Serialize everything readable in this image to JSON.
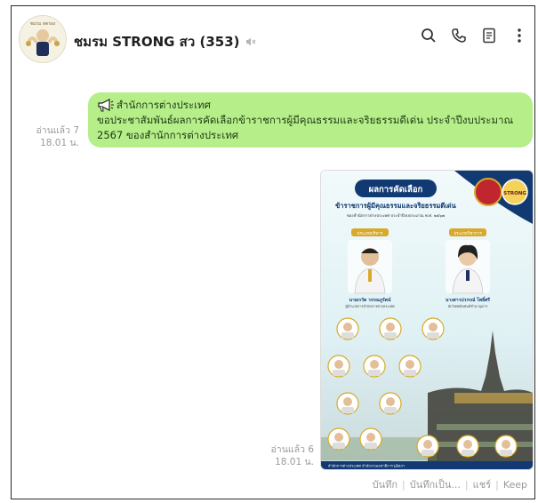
{
  "header": {
    "title": "ชมรม STRONG สว (353)",
    "avatar_caption": "ชมรม สตรอง"
  },
  "icons": {
    "mute": "speaker-muted-icon",
    "search": "search-icon",
    "call": "phone-icon",
    "notes": "notes-icon",
    "menu": "kebab-menu-icon"
  },
  "messages": [
    {
      "read": "อ่านแล้ว 7",
      "time": "18.01 น.",
      "line1": "สำนักการต่างประเทศ",
      "line2": "ขอประชาสัมพันธ์ผลการคัดเลือกข้าราชการผู้มีคุณธรรมและจริยธรรมดีเด่น ประจำปีงบประมาณ",
      "line3": "2567 ของสำนักการต่างประเทศ"
    },
    {
      "read": "อ่านแล้ว 6",
      "time": "18.01 น."
    }
  ],
  "poster": {
    "banner": "ผลการคัดเลือก",
    "heading": "ข้าราชการผู้มีคุณธรรมและจริยธรรมดีเด่น",
    "subheading": "ของสำนักการต่างประเทศ ประจำปีงบประมาณ พ.ศ. ๒๕๖๗",
    "badge_left": "ประเภทบริหาร",
    "badge_right": "ประเภทวิชาการ",
    "name_left": "นายเรวัต วรรณภูรัตน์",
    "role_left": "ผู้อำนวยการสำนักการต่างประเทศ",
    "name_right": "นางสาวปวรรณ์ โพธิ์ศรี",
    "role_right": "นักวิเทศสัมพันธ์ชำนาญการ",
    "logo_right": "STRONG",
    "footer": "สำนักการต่างประเทศ สำนักงานเลขาธิการวุฒิสภา"
  },
  "actions": {
    "a1": "บันทึก",
    "a2": "บันทึกเป็น...",
    "a3": "แชร์",
    "a4": "Keep"
  },
  "colors": {
    "bubble": "#b6ee8a",
    "poster_bg": "#eaf6f8",
    "banner": "#123a72",
    "gold": "#d8a92a"
  }
}
